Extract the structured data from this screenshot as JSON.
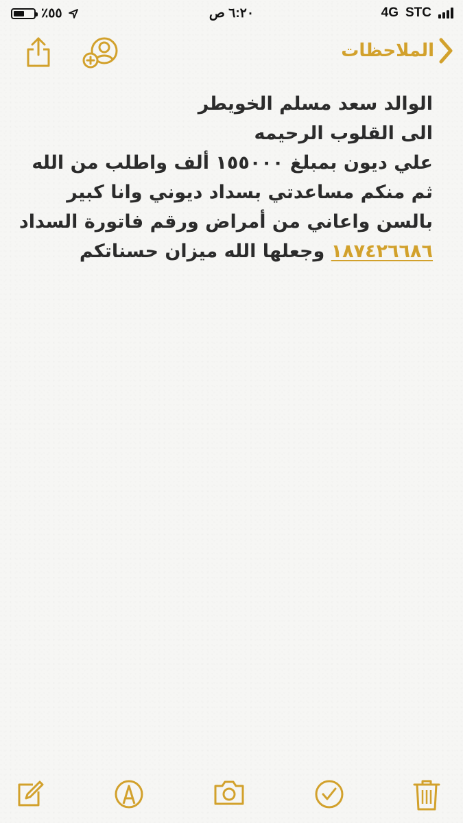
{
  "status_bar": {
    "battery_percent": "٪٥٥",
    "battery_level": 0.55,
    "time": "٦:٢٠ ص",
    "network": "4G",
    "carrier": "STC",
    "location_icon": "location-arrow-icon"
  },
  "nav": {
    "back_label": "الملاحظات",
    "back_icon": "chevron-right-icon",
    "share_icon": "share-icon",
    "add_person_icon": "add-person-icon"
  },
  "note": {
    "lines": [
      "الوالد سعد مسلم الخويطر",
      "الى القلوب الرحيمه",
      "علي ديون بمبلغ ١٥٥٠٠٠ ألف      واطلب من الله",
      "ثم منكم مساعدتي بسداد ديوني  وانا كبير",
      "بالسن واعاني من أمراض  ورقم فاتورة السداد"
    ],
    "last_line_phone": "١٨٧٤٢٦٦٨٦",
    "last_line_text": "  وجعلها الله  ميزان حسناتكم"
  },
  "toolbar": {
    "icons": [
      "compose-icon",
      "markup-icon",
      "camera-icon",
      "checklist-icon",
      "trash-icon"
    ]
  },
  "colors": {
    "accent": "#d2a12c",
    "text": "#2b2b2b",
    "background": "#f6f6f4"
  }
}
